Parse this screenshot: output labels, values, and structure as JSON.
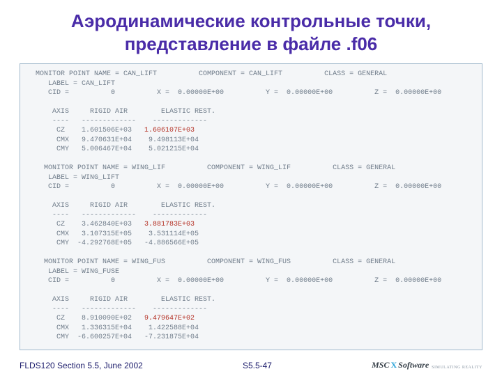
{
  "title_line1": "Аэродинамические контрольные точки,",
  "title_line2": "представление в файле .f06",
  "mon": [
    {
      "header": "  MONITOR POINT NAME = CAN_LIFT          COMPONENT = CAN_LIFT          CLASS = GENERAL",
      "label": "     LABEL = CAN_LIFT",
      "cid": "     CID =          0          X =  0.00000E+00          Y =  0.00000E+00          Z =  0.00000E+00",
      "blank": "",
      "axis": "      AXIS     RIGID AIR        ELASTIC REST.",
      "rule": "      ----   -------------    -------------",
      "cz_l": "       CZ    1.601506E+03   ",
      "cz_r": "1.606107E+03",
      "cmx": "       CMX   9.470631E+04    9.498113E+04",
      "cmy": "       CMY   5.006467E+04    5.021215E+04"
    },
    {
      "header": "    MONITOR POINT NAME = WING_LIF          COMPONENT = WING_LIF          CLASS = GENERAL",
      "label": "     LABEL = WING_LIFT",
      "cid": "     CID =          0          X =  0.00000E+00          Y =  0.00000E+00          Z =  0.00000E+00",
      "blank": "",
      "axis": "      AXIS     RIGID AIR        ELASTIC REST.",
      "rule": "      ----   -------------    -------------",
      "cz_l": "       CZ    3.462840E+03   ",
      "cz_r": "3.881783E+03",
      "cmx": "       CMX   3.107315E+05    3.531114E+05",
      "cmy": "       CMY  -4.292768E+05   -4.886566E+05"
    },
    {
      "header": "    MONITOR POINT NAME = WING_FUS          COMPONENT = WING_FUS          CLASS = GENERAL",
      "label": "     LABEL = WING_FUSE",
      "cid": "     CID =          0          X =  0.00000E+00          Y =  0.00000E+00          Z =  0.00000E+00",
      "blank": "",
      "axis": "      AXIS     RIGID AIR        ELASTIC REST.",
      "rule": "      ----   -------------    -------------",
      "cz_l": "       CZ    8.910090E+02   ",
      "cz_r": "9.479647E+02",
      "cmx": "       CMX   1.336315E+04    1.422588E+04",
      "cmy": "       CMY  -6.600257E+04   -7.231875E+04"
    }
  ],
  "footer": {
    "left": "FLDS120 Section 5.5, June 2002",
    "center": "S5.5-47",
    "logo_msc": "MSC",
    "logo_x": "X",
    "logo_soft": "Software",
    "logo_tag": "SIMULATING REALITY"
  }
}
